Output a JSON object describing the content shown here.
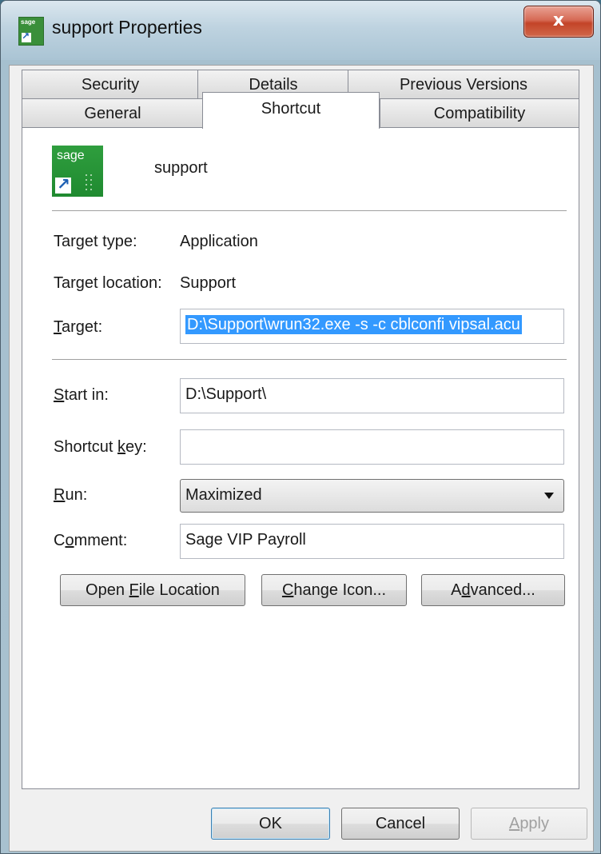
{
  "window": {
    "title": "support Properties",
    "close_glyph": "x",
    "app_icon": "sage-shortcut-icon"
  },
  "tabs": {
    "row1": [
      "Security",
      "Details",
      "Previous Versions"
    ],
    "row2": [
      "General",
      "Shortcut",
      "Compatibility"
    ],
    "active": "Shortcut"
  },
  "shortcut": {
    "icon_text": "sage",
    "name": "support",
    "target_type_label": "Target type:",
    "target_type_value": "Application",
    "target_location_label": "Target location:",
    "target_location_value": "Support",
    "target_label_key": "T",
    "target_label_rest": "arget:",
    "target_value": "D:\\Support\\wrun32.exe -s -c cblconfi vipsal.acu",
    "start_in_label_key": "S",
    "start_in_label_rest": "tart in:",
    "start_in_value": "D:\\Support\\",
    "shortcut_key_label_pre": "Shortcut ",
    "shortcut_key_label_key": "k",
    "shortcut_key_label_rest": "ey:",
    "shortcut_key_value": "",
    "run_label_key": "R",
    "run_label_rest": "un:",
    "run_value": "Maximized",
    "comment_label_pre": "C",
    "comment_label_key": "o",
    "comment_label_rest": "mment:",
    "comment_value": "Sage VIP Payroll"
  },
  "buttons": {
    "open_file_pre": "Open ",
    "open_file_key": "F",
    "open_file_rest": "ile Location",
    "change_icon_key": "C",
    "change_icon_rest": "hange Icon...",
    "advanced_pre": "A",
    "advanced_key": "d",
    "advanced_rest": "vanced...",
    "ok": "OK",
    "cancel": "Cancel",
    "apply_key": "A",
    "apply_rest": "pply"
  },
  "colors": {
    "selection": "#3399ff",
    "close_button": "#c34428",
    "sage_green": "#2f9e3e"
  }
}
